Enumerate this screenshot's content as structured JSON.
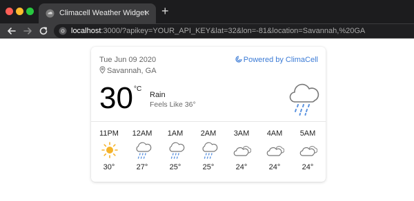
{
  "browser": {
    "tab_title": "Climacell Weather Widget",
    "tab_close": "×",
    "new_tab": "+",
    "url_host": "localhost",
    "url_rest": ":3000/?apikey=YOUR_API_KEY&lat=32&lon=-81&location=Savannah,%20GA"
  },
  "widget": {
    "date": "Tue Jun 09 2020",
    "location": "Savannah, GA",
    "powered_by": "Powered by ClimaCell",
    "temperature": "30",
    "unit": "°C",
    "condition": "Rain",
    "feels_like": "Feels Like 36°",
    "current_icon": "rain-cloud-icon",
    "hourly": [
      {
        "time": "11PM",
        "temp": "30°",
        "icon": "sun-icon"
      },
      {
        "time": "12AM",
        "temp": "27°",
        "icon": "rain-cloud-icon"
      },
      {
        "time": "1AM",
        "temp": "25°",
        "icon": "rain-cloud-icon"
      },
      {
        "time": "2AM",
        "temp": "25°",
        "icon": "rain-cloud-icon"
      },
      {
        "time": "3AM",
        "temp": "24°",
        "icon": "cloudy-icon"
      },
      {
        "time": "4AM",
        "temp": "24°",
        "icon": "cloudy-icon"
      },
      {
        "time": "5AM",
        "temp": "24°",
        "icon": "cloudy-icon"
      }
    ]
  },
  "colors": {
    "accent_link": "#3b7bd6",
    "rain_drops": "#5b93e0",
    "sun": "#f5b32a",
    "icon_stroke": "#777777"
  }
}
